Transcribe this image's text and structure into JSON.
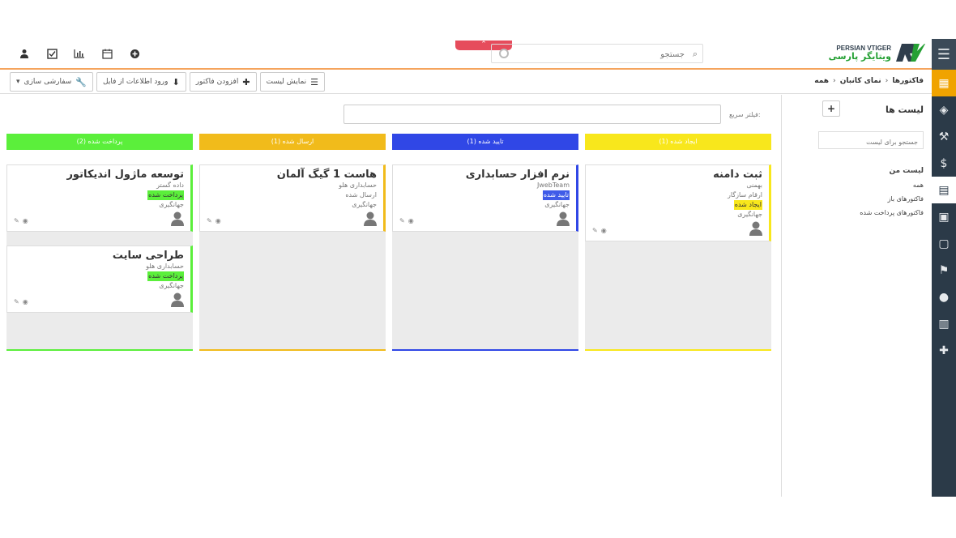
{
  "header": {
    "logo_en": "PERSIAN VTIGER",
    "logo_fa": "ویتایگر پارسی",
    "search_placeholder": "جستجو"
  },
  "breadcrumb": [
    "فاکتورها",
    "نمای کانبان",
    "همه"
  ],
  "toolbar": {
    "customize": "سفارشی سازی",
    "import": "ورود اطلاعات از فایل",
    "add_invoice": "افزودن فاکتور",
    "list_view": "نمایش لیست"
  },
  "lists_panel": {
    "title": "لیست ها",
    "add": "+",
    "search_placeholder": "جستجو برای لیست",
    "my_list_title": "لیست من",
    "items": [
      "همه",
      "فاکتورهای باز",
      "فاکتورهای پرداخت شده"
    ]
  },
  "quick_filter_label": "فیلتر سریع:",
  "columns": [
    {
      "title": "ایجاد شده (1)",
      "color": "#f8e71c",
      "cards": [
        {
          "title": "ثبت دامنه",
          "lines": [
            "بهمنی",
            "ارقام سازگار"
          ],
          "status": "ایجاد شده",
          "owner": "جهانگیری",
          "tag_bg": "#f8e71c",
          "tag_fg": "#333"
        }
      ]
    },
    {
      "title": "تایید شده (1)",
      "color": "#3047e6",
      "cards": [
        {
          "title": "نرم افزار حسابداری",
          "lines": [
            "JwebTeam"
          ],
          "status": "تایید شده",
          "owner": "جهانگیری",
          "tag_bg": "#3f5be8",
          "tag_fg": "#fff"
        }
      ]
    },
    {
      "title": "ارسال شده (1)",
      "color": "#f1bb1b",
      "cards": [
        {
          "title": "هاست 1 گیگ آلمان",
          "lines": [
            "حسابداری هلو",
            "ارسال شده"
          ],
          "status": "",
          "owner": "جهانگیری",
          "tag_bg": "#f1bb1b",
          "tag_fg": "#333"
        }
      ]
    },
    {
      "title": "پرداخت شده (2)",
      "color": "#5bef3b",
      "cards": [
        {
          "title": "توسعه ماژول اندیکاتور",
          "lines": [
            "داده گستر"
          ],
          "status": "پرداخت شده",
          "owner": "جهانگیری",
          "tag_bg": "#5bef3b",
          "tag_fg": "#333"
        },
        {
          "title": "طراحی سایت",
          "lines": [
            "حسابداری هلو"
          ],
          "status": "پرداخت شده",
          "owner": "جهانگیری",
          "tag_bg": "#5bef3b",
          "tag_fg": "#333"
        }
      ]
    }
  ]
}
